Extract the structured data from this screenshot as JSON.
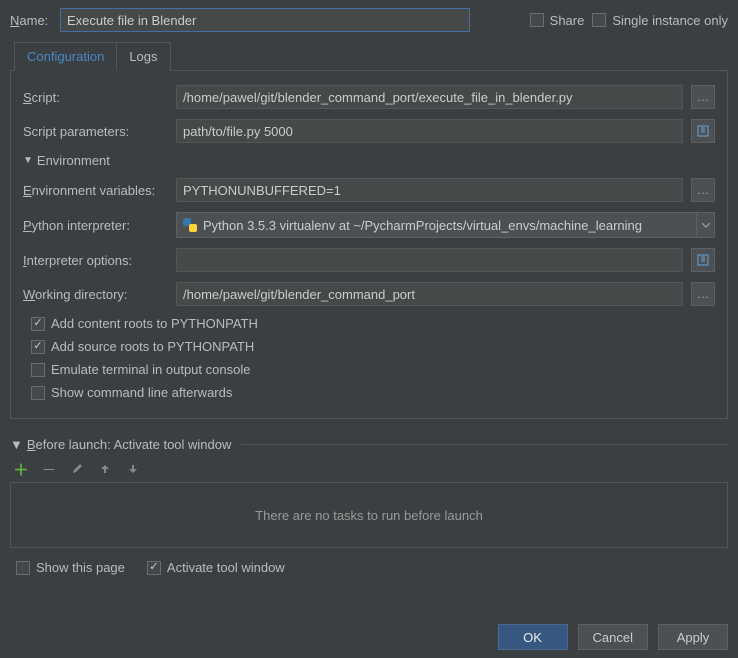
{
  "top": {
    "name_label": "Name:",
    "name_value": "Execute file in Blender",
    "share_label": "Share",
    "single_instance_label": "Single instance only"
  },
  "tabs": {
    "configuration": "Configuration",
    "logs": "Logs"
  },
  "form": {
    "script_label": "Script:",
    "script_value": "/home/pawel/git/blender_command_port/execute_file_in_blender.py",
    "params_label": "Script parameters:",
    "params_value": "path/to/file.py 5000",
    "env_section": "Environment",
    "envvars_label": "Environment variables:",
    "envvars_value": "PYTHONUNBUFFERED=1",
    "interp_label": "Python interpreter:",
    "interp_value": "Python 3.5.3 virtualenv at ~/PycharmProjects/virtual_envs/machine_learning",
    "interpopts_label": "Interpreter options:",
    "interpopts_value": "",
    "workdir_label": "Working directory:",
    "workdir_value": "/home/pawel/git/blender_command_port"
  },
  "checks": {
    "content_roots": "Add content roots to PYTHONPATH",
    "source_roots": "Add source roots to PYTHONPATH",
    "emulate_terminal": "Emulate terminal in output console",
    "show_cmd": "Show command line afterwards"
  },
  "before_launch": {
    "head": "Before launch: Activate tool window",
    "empty": "There are no tasks to run before launch",
    "show_page": "Show this page",
    "activate_tool": "Activate tool window"
  },
  "buttons": {
    "ok": "OK",
    "cancel": "Cancel",
    "apply": "Apply"
  }
}
